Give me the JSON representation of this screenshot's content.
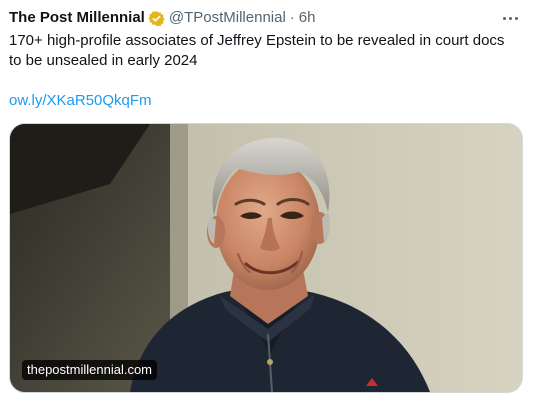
{
  "tweet": {
    "author": {
      "display_name": "The Post Millennial",
      "handle": "@TPostMillennial",
      "verified_badge_color": "#e2b719",
      "separator": "·",
      "time": "6h"
    },
    "more_menu_icon": "more-horizontal-icon",
    "text": "170+ high-profile associates of Jeffrey Epstein to be revealed in court docs to be unsealed in early 2024",
    "link": "ow.ly/XKaR50QkqFm",
    "media": {
      "description_icon": "photo",
      "source_label": "thepostmillennial.com"
    },
    "colors": {
      "text": "#0f1419",
      "secondary": "#536471",
      "link": "#1d9bf0",
      "border": "#cfd9de"
    }
  }
}
